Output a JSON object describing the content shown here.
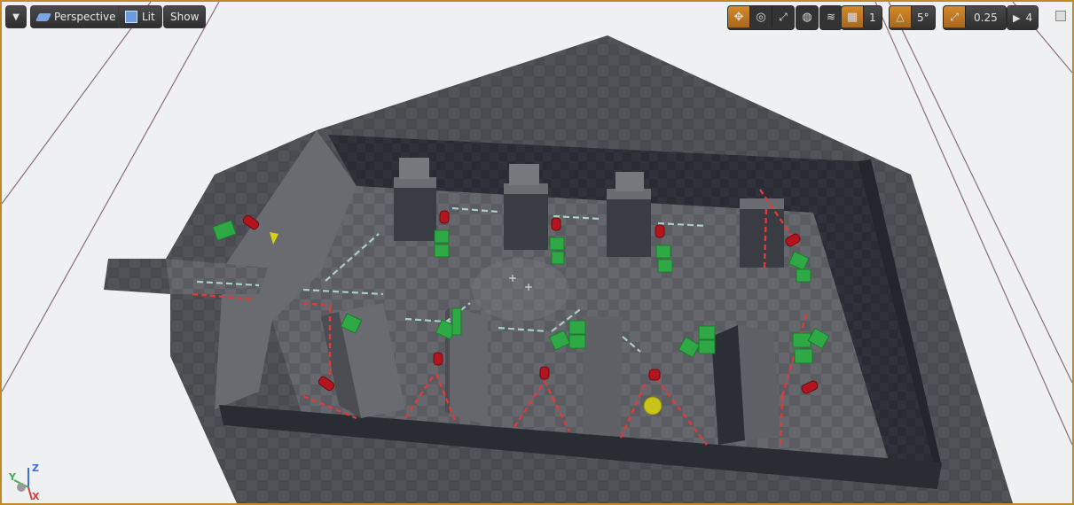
{
  "viewport": {
    "menu_icon": "chevron-down-icon",
    "view_mode": "Perspective",
    "lighting_mode": "Lit",
    "show_label": "Show"
  },
  "transform_toolbar": {
    "grid_snap_value": "1",
    "rotation_snap_value": "5°",
    "scale_snap_value": "0.25",
    "camera_speed_value": "4"
  },
  "axis_gizmo": {
    "z": "Z",
    "y": "Y",
    "x": "X"
  },
  "colors": {
    "accent": "#d38a2a",
    "selection_border": "#c08a2a",
    "floor": "#5a5b60",
    "wall_dark": "#2b2d36",
    "green_cube": "#2fa846",
    "red_target": "#b3141e",
    "yellow_ball": "#c8c41a"
  }
}
